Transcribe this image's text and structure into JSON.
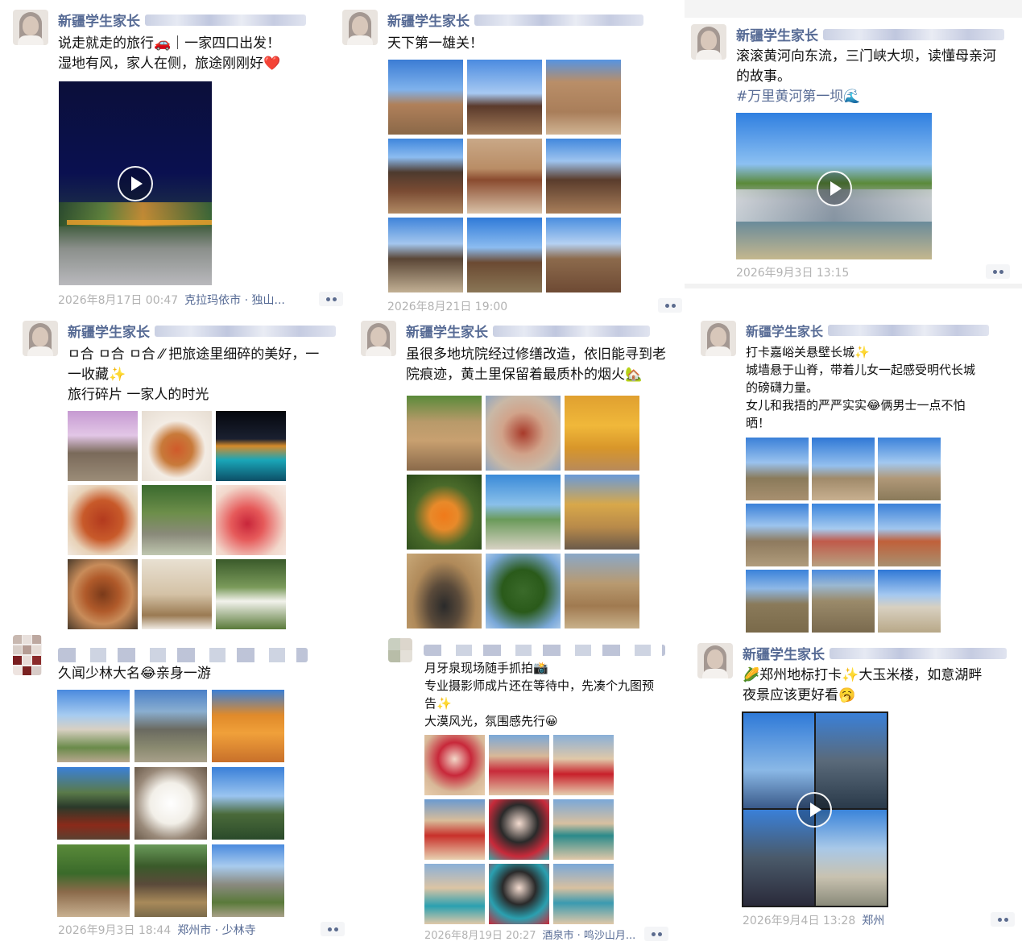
{
  "common": {
    "nickname": "新疆学生家长"
  },
  "posts": [
    {
      "lines": [
        "说走就走的旅行🚗｜一家四口出发！",
        "湿地有风，家人在侧，旅途刚刚好❤️"
      ],
      "time": "2026年8月17日 00:47",
      "location": "克拉玛依市 · 独山..."
    },
    {
      "lines": [
        "天下第一雄关！"
      ],
      "time": "2026年8月21日 19:00",
      "location": ""
    },
    {
      "lines": [
        "滚滚黄河向东流，三门峡大坝，读懂母亲河",
        "的故事。"
      ],
      "hashtag": "#万里黄河第一坝🌊",
      "time": "2026年9月3日 13:15",
      "location": ""
    },
    {
      "lines": [
        "ㅁ合 ㅁ合 ㅁ合 ⁄⁄ 把旅途里细碎的美好，一",
        "一收藏✨",
        "旅行碎片 一家人的时光"
      ],
      "time": "",
      "location": ""
    },
    {
      "lines": [
        "虽很多地坑院经过修缮改造，依旧能寻到老",
        "院痕迹，黄土里保留着最质朴的烟火🏡"
      ],
      "time": "",
      "location": ""
    },
    {
      "lines": [
        "打卡嘉峪关悬壁长城✨",
        "城墙悬于山脊，带着儿女一起感受明代长城",
        "的磅礴力量。",
        "女儿和我捂的严严实实😂俩男士一点不怕",
        "晒！"
      ],
      "time": "",
      "location": ""
    },
    {
      "lines": [
        "久闻少林大名😂亲身一游"
      ],
      "time": "2026年9月3日 18:44",
      "location": "郑州市 · 少林寺"
    },
    {
      "lines": [
        "月牙泉现场随手抓拍📸",
        "专业摄影师成片还在等待中，先凑个九图预",
        "告✨",
        "大漠风光，氛围感先行😀"
      ],
      "time": "2026年8月19日 20:27",
      "location": "酒泉市 · 鸣沙山月..."
    },
    {
      "lines": [
        "🌽郑州地标打卡✨大玉米楼，如意湖畔",
        "夜景应该更好看🥱"
      ],
      "time": "2026年9月4日 13:28",
      "location": "郑州"
    }
  ],
  "icons": {
    "play": "play-icon",
    "more": "more-dots-icon",
    "avatar": "avatar-photo"
  },
  "colors": {
    "nickname": "#576b95",
    "meta": "#b2b2b2",
    "text": "#111111"
  }
}
